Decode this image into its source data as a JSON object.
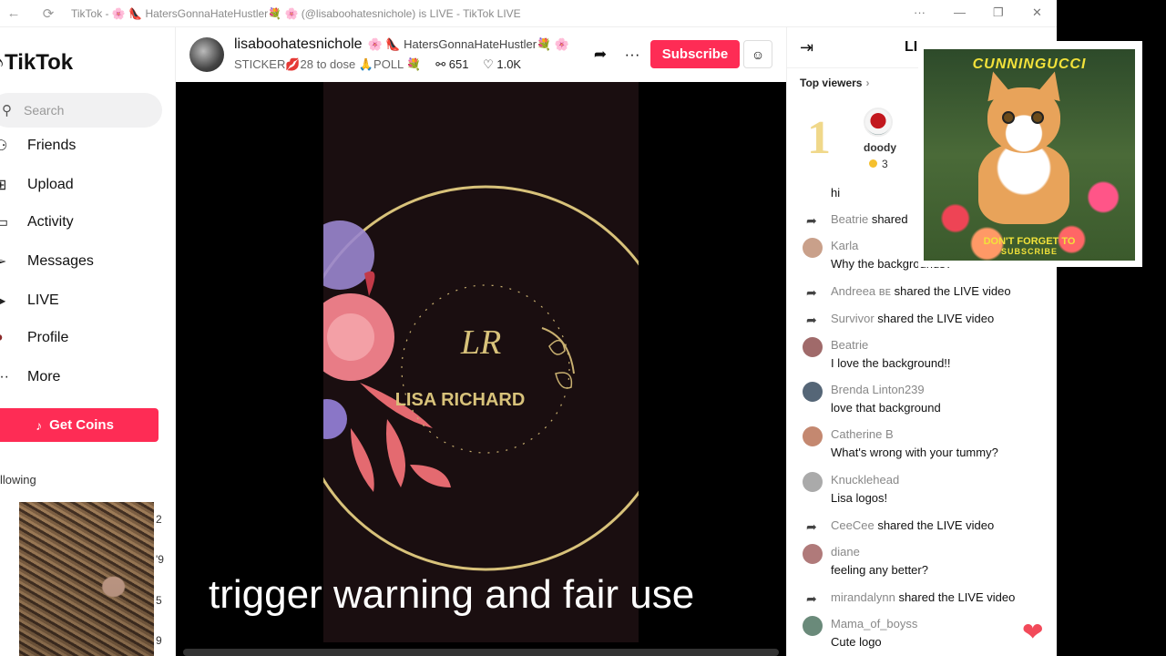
{
  "window": {
    "title": "TikTok - 🌸 👠 HatersGonnaHateHustler💐 🌸 (@lisaboohatesnichole) is LIVE - TikTok LIVE",
    "back_glyph": "←",
    "reload_glyph": "⟳",
    "more_glyph": "···",
    "minimize_glyph": "—",
    "restore_glyph": "❐",
    "close_glyph": "✕"
  },
  "sidebar": {
    "logo_text": "TikTok",
    "logo_glyph": "♪",
    "search_placeholder": "Search",
    "items": [
      {
        "label": "Friends",
        "icon": "friends-icon",
        "glyph": "⚇"
      },
      {
        "label": "Upload",
        "icon": "upload-icon",
        "glyph": "⊞"
      },
      {
        "label": "Activity",
        "icon": "activity-icon",
        "glyph": "▭"
      },
      {
        "label": "Messages",
        "icon": "messages-icon",
        "glyph": "➢"
      },
      {
        "label": "LIVE",
        "icon": "live-icon",
        "glyph": "▶"
      },
      {
        "label": "Profile",
        "icon": "profile-icon",
        "glyph": "●"
      },
      {
        "label": "More",
        "icon": "more-icon",
        "glyph": "···"
      }
    ],
    "get_coins_label": "Get Coins",
    "following_label": "llowing",
    "following_numbers": [
      "2",
      "'9",
      "5",
      "9"
    ]
  },
  "stream": {
    "username": "lisaboohatesnichole",
    "nickname": "🌸 👠 HatersGonnaHateHustler💐 🌸",
    "info": "STICKER💋28 to dose 🙏POLL 💐",
    "viewers": "651",
    "likes": "1.0K",
    "share_glyph": "➦",
    "more_glyph": "···",
    "subscribe_label": "Subscribe",
    "friend_glyph": "☺",
    "caption": "trigger warning and fair use"
  },
  "video_overlay": {
    "brand_monogram": "LR",
    "brand_name": "LISA RICHARD"
  },
  "panel": {
    "title": "LI",
    "collapse_glyph": "⇥",
    "top_viewers_label": "Top viewers",
    "top_viewer": {
      "rank": "1",
      "name": "doody",
      "coins": "3"
    },
    "chat": [
      {
        "type": "text_only",
        "text": "hi"
      },
      {
        "type": "share",
        "name": "Beatrie",
        "action": " shared "
      },
      {
        "type": "comment",
        "name": "Karla",
        "text": "Why the backgrounds?",
        "color": "#c9a08a"
      },
      {
        "type": "share",
        "name": "Andreea ʙᴇ",
        "action": " shared the LIVE video"
      },
      {
        "type": "share",
        "name": "Survivor",
        "action": " shared the LIVE video"
      },
      {
        "type": "comment",
        "name": "Beatrie",
        "text": "I love the background!!",
        "color": "#a06a6a"
      },
      {
        "type": "comment",
        "name": "Brenda Linton239",
        "text": "love that background",
        "color": "#556677"
      },
      {
        "type": "comment",
        "name": "Catherine B",
        "text": "What's wrong with your tummy?",
        "color": "#c48870"
      },
      {
        "type": "comment",
        "name": "Knucklehead",
        "text": "Lisa logos!",
        "color": "#aaaaaa"
      },
      {
        "type": "share",
        "name": "CeeCee",
        "action": " shared the LIVE video"
      },
      {
        "type": "comment",
        "name": "diane",
        "text": "feeling any better?",
        "color": "#b07a7a"
      },
      {
        "type": "share",
        "name": "mirandalynn",
        "action": " shared the LIVE video"
      },
      {
        "type": "comment",
        "name": "Mama_of_boyss",
        "text": "Cute logo",
        "color": "#6a8a7a"
      }
    ],
    "heart_glyph": "❤"
  },
  "promo_card": {
    "title": "CUNNINGUCCI",
    "cta_line1": "DON'T FORGET TO",
    "cta_line2": "SUBSCRIBE"
  },
  "colors": {
    "accent": "#fe2c55",
    "gold": "#d8c27a",
    "heart": "#f24a5a"
  }
}
